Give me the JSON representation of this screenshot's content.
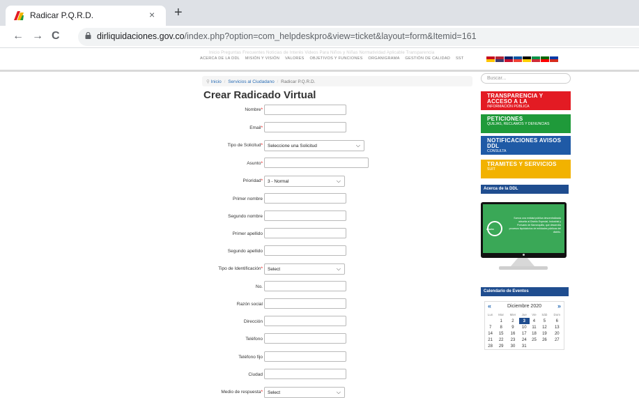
{
  "browser": {
    "tab_title": "Radicar P.Q.R.D.",
    "tab_close": "×",
    "new_tab": "+",
    "url_host": "dirliquidaciones.gov.co",
    "url_path": "/index.php?option=com_helpdeskpro&view=ticket&layout=form&Itemid=161",
    "back": "←",
    "forward": "→",
    "reload": "C"
  },
  "header": {
    "top_menu": "Inicio     Preguntas Frecuentes     Noticias de Interés     Videos     Para Niños y Niñas     Normatividad Aplicable     Transparencia",
    "main_menu": [
      "ACERCA DE LA DDL",
      "MISIÓN Y VISIÓN",
      "VALORES",
      "OBJETIVOS Y FUNCIONES",
      "ORGANIGRAMA",
      "GESTIÓN DE CALIDAD",
      "SST"
    ],
    "flags": [
      {
        "name": "spanish-flag",
        "c1": "#c60b1e",
        "c2": "#ffc400"
      },
      {
        "name": "english-us-flag",
        "c1": "#b22234",
        "c2": "#3c3b6e"
      },
      {
        "name": "english-uk-flag",
        "c1": "#012169",
        "c2": "#c8102e"
      },
      {
        "name": "french-flag",
        "c1": "#0055a4",
        "c2": "#ef4135"
      },
      {
        "name": "german-flag",
        "c1": "#000000",
        "c2": "#ffce00"
      },
      {
        "name": "italian-flag",
        "c1": "#009246",
        "c2": "#ce2b37"
      },
      {
        "name": "portuguese-flag",
        "c1": "#006600",
        "c2": "#ff0000"
      },
      {
        "name": "russian-flag",
        "c1": "#0039a6",
        "c2": "#d52b1e"
      }
    ]
  },
  "breadcrumb": {
    "home": "Inicio",
    "section": "Servicios al Ciudadano",
    "current": "Radicar P.Q.R.D.",
    "sep": "/"
  },
  "form": {
    "title": "Crear Radicado Virtual",
    "required_mark": "*",
    "fields": {
      "nombre": "Nombre",
      "email": "Email",
      "tipo_solicitud": "Tipo de Solicitud",
      "tipo_solicitud_value": "Seleccione una Solicitud",
      "asunto": "Asunto",
      "prioridad": "Prioridad",
      "prioridad_value": "3 - Normal",
      "primer_nombre": "Primer nombre",
      "segundo_nombre": "Segundo nombre",
      "primer_apellido": "Primer apellido",
      "segundo_apellido": "Segundo apellido",
      "tipo_identificacion": "Tipo de Identificación",
      "tipo_identificacion_value": "Select",
      "no": "No.",
      "razon_social": "Razón social",
      "direccion": "Dirección",
      "telefono": "Teléfono",
      "telefono_fijo": "Teléfono fijo",
      "ciudad": "Ciudad",
      "medio_respuesta": "Medio de respuesta",
      "medio_respuesta_value": "Select"
    }
  },
  "sidebar": {
    "search_placeholder": "Buscar...",
    "promos": [
      {
        "title": "TRANSPARENCIA Y ACCESO A LA",
        "sub": "INFORMACIÓN PÚBLICA",
        "color": "#e31b23"
      },
      {
        "title": "PETICIONES",
        "sub": "QUEJAS, RECLAMOS Y DENUNCIAS",
        "color": "#1f9a3a"
      },
      {
        "title": "NOTIFICACIONES AVISOS DDL",
        "sub": "CONSULTA",
        "color": "#1f5aa6"
      },
      {
        "title": "TRAMITES Y SERVICIOS",
        "sub": "SUIT",
        "color": "#f2b200"
      }
    ],
    "about_head": "Acerca de la DDL",
    "about_text": "Somos una entidad pública descentralizada adscrita al Distrito Especial, Industrial y Portuario de Barranquilla, que desarrolla procesos liquidatorios de entidades públicas del distrito.",
    "about_badge": "MISIÓN",
    "calendar_head": "Calendario de Eventos",
    "calendar": {
      "month": "Diciembre 2020",
      "prev": "«",
      "next": "»",
      "days": [
        "Lun",
        "Mar",
        "Mier",
        "Jue",
        "Vie",
        "Sáb",
        "Dom"
      ],
      "weeks": [
        [
          "",
          "1",
          "2",
          "3",
          "4",
          "5",
          "6"
        ],
        [
          "7",
          "8",
          "9",
          "10",
          "11",
          "12",
          "13"
        ],
        [
          "14",
          "15",
          "16",
          "17",
          "18",
          "19",
          "20"
        ],
        [
          "21",
          "22",
          "23",
          "24",
          "25",
          "26",
          "27"
        ],
        [
          "28",
          "29",
          "30",
          "31",
          "",
          "",
          ""
        ]
      ],
      "today": "3"
    }
  }
}
